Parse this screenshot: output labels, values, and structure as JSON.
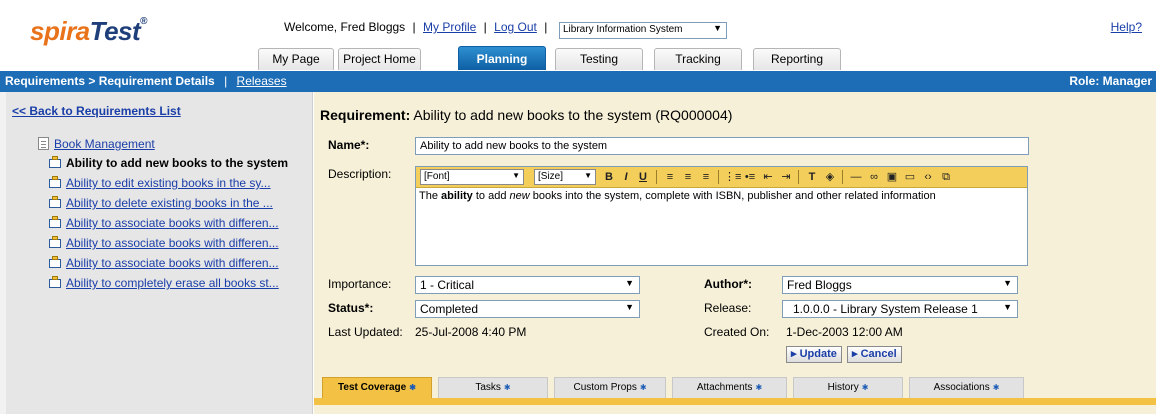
{
  "header": {
    "logo_part1": "spira",
    "logo_part2": "Test",
    "logo_tm": "®",
    "welcome": "Welcome, Fred Bloggs",
    "my_profile": "My Profile",
    "log_out": "Log Out",
    "sep": "|",
    "project_select": "Library Information System",
    "help": "Help?"
  },
  "tabs": [
    {
      "label": "My Page"
    },
    {
      "label": "Project Home"
    },
    {
      "label": "Planning"
    },
    {
      "label": "Testing"
    },
    {
      "label": "Tracking"
    },
    {
      "label": "Reporting"
    }
  ],
  "bluebar": {
    "breadcrumb": "Requirements > Requirement Details",
    "sep": "|",
    "releases": "Releases",
    "role": "Role: Manager"
  },
  "left": {
    "back_link": "<< Back to Requirements List",
    "parent": "Book Management",
    "items": [
      {
        "label": "Ability to add new books to the system"
      },
      {
        "label": "Ability to edit existing books in the sy..."
      },
      {
        "label": "Ability to delete existing books in the ..."
      },
      {
        "label": "Ability to associate books with differen..."
      },
      {
        "label": "Ability to associate books with differen..."
      },
      {
        "label": "Ability to associate books with differen..."
      },
      {
        "label": "Ability to completely erase all books st..."
      }
    ]
  },
  "main": {
    "title_label": "Requirement:",
    "title_value": "Ability to add new books to the system (RQ000004)",
    "name_label": "Name*:",
    "name_value": "Ability to add new books to the system",
    "description_label": "Description:",
    "editor": {
      "font": "[Font]",
      "size": "[Size]",
      "bold": "B",
      "italic": "I",
      "underline": "U",
      "body_part1": "The ",
      "body_bold": "ability",
      "body_part2": " to add ",
      "body_italic": "new",
      "body_part3": " books into the system, complete with ISBN, publisher and other related information"
    },
    "importance_label": "Importance:",
    "importance_value": "1 - Critical",
    "status_label": "Status*:",
    "status_value": "Completed",
    "last_updated_label": "Last Updated:",
    "last_updated_value": "25-Jul-2008 4:40 PM",
    "author_label": "Author*:",
    "author_value": "Fred Bloggs",
    "release_label": "Release:",
    "release_value": "1.0.0.0 - Library System Release 1",
    "created_on_label": "Created On:",
    "created_on_value": "1-Dec-2003 12:00 AM",
    "update_button": "▸ Update",
    "cancel_button": "▸ Cancel"
  },
  "bottom_tabs": [
    {
      "label": "Test Coverage"
    },
    {
      "label": "Tasks"
    },
    {
      "label": "Custom Props"
    },
    {
      "label": "Attachments"
    },
    {
      "label": "History"
    },
    {
      "label": "Associations"
    }
  ],
  "colors": {
    "brand_blue": "#1c6cb6",
    "active_tab_blue": "#0e5fa3",
    "logo_orange": "#e8731a",
    "panel_yellow": "#f6f0d8",
    "toolbar_yellow": "#f4ce5a",
    "active_bottom_tab": "#f3c245"
  },
  "icons": {
    "parent_node": "document-icon",
    "child_node": "requirement-icon",
    "dropdown": "chevron-down-icon"
  }
}
